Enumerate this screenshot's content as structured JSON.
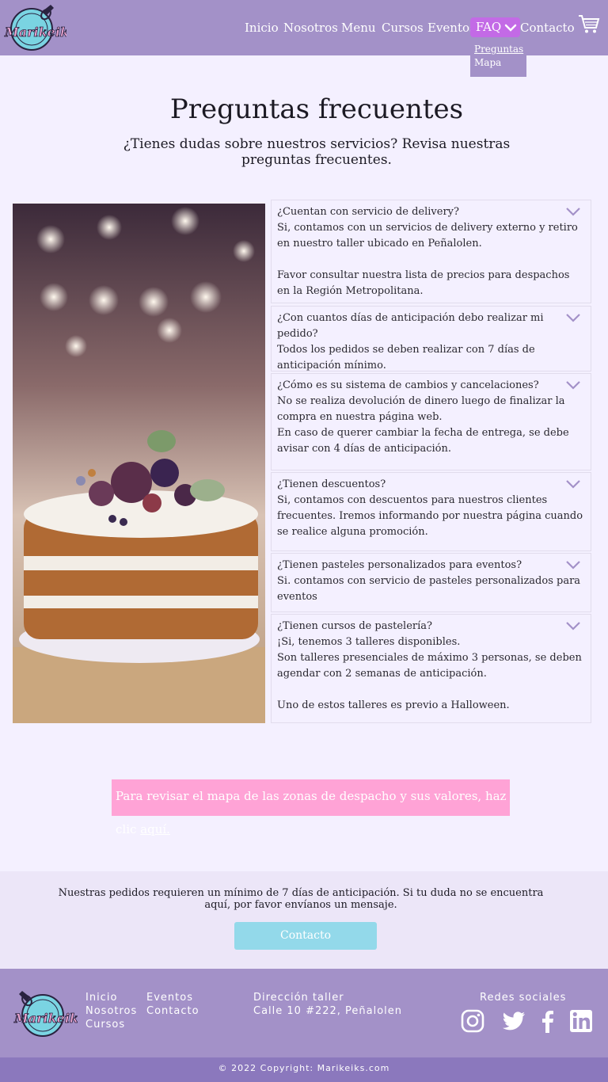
{
  "nav": {
    "brand": "Marikeiks",
    "links": [
      "Inicio",
      "Nosotros",
      "Menu",
      "Cursos",
      "Eventos"
    ],
    "faq_label": "FAQ",
    "contact_label": "Contacto",
    "dropdown": [
      "Preguntas",
      "Mapa"
    ]
  },
  "hero": {
    "title": "Preguntas frecuentes",
    "subtitle": "¿Tienes dudas sobre nuestros servicios? Revisa nuestras preguntas frecuentes."
  },
  "faq": [
    {
      "q": "¿Cuentan con servicio de delivery?",
      "a": "Si, contamos con un servicios de delivery externo y retiro en nuestro taller ubicado en Peñalolen.\n\nFavor consultar nuestra lista de precios para despachos en la Región Metropolitana."
    },
    {
      "q": "¿Con cuantos días de anticipación debo realizar mi pedido?",
      "a": "Todos los pedidos se deben realizar con 7 días de anticipación mínimo."
    },
    {
      "q": "¿Cómo es su sistema de cambios y cancelaciones?",
      "a": "No se realiza devolución de dinero luego de finalizar la compra en nuestra página web.\nEn caso de querer cambiar la fecha de entrega, se debe avisar con 4 días de anticipación."
    },
    {
      "q": "¿Tienen descuentos?",
      "a": "Si, contamos con descuentos para nuestros clientes frecuentes. Iremos informando por nuestra página cuando se realice alguna promoción."
    },
    {
      "q": "¿Tienen pasteles personalizados para eventos?",
      "a": "Si. contamos con servicio de pasteles personalizados para eventos"
    },
    {
      "q": "¿Tienen cursos de pastelería?",
      "a": "¡Si, tenemos 3 talleres disponibles.\nSon talleres presenciales de máximo 3 personas, se deben agendar con 2 semanas de anticipación.\n\nUno de estos talleres es previo a Halloween."
    }
  ],
  "map_note": {
    "text": "Para revisar el mapa de las zonas de despacho y sus valores, haz clic ",
    "link": "aquí."
  },
  "contact_band": {
    "text": "Nuestras pedidos requieren un mínimo de 7 días de anticipación. Si tu duda no se encuentra aquí, por favor envíanos un mensaje.",
    "button": "Contacto"
  },
  "footer": {
    "col1": [
      "Inicio",
      "Nosotros",
      "Cursos"
    ],
    "col2": [
      "Eventos",
      "Contacto"
    ],
    "address_title": "Dirección taller",
    "address": "Calle 10 #222, Peñalolen",
    "social_title": "Redes sociales",
    "social": [
      "instagram-icon",
      "twitter-icon",
      "facebook-icon",
      "linkedin-icon"
    ],
    "copyright": "© 2022 Copyright: Marikeiks.com"
  },
  "colors": {
    "nav": "#a391c8",
    "faq_active": "#c36ae6",
    "map_note": "#ffa3d6",
    "contact_btn": "#93d9ea",
    "page_bg": "#f4f0ff"
  }
}
